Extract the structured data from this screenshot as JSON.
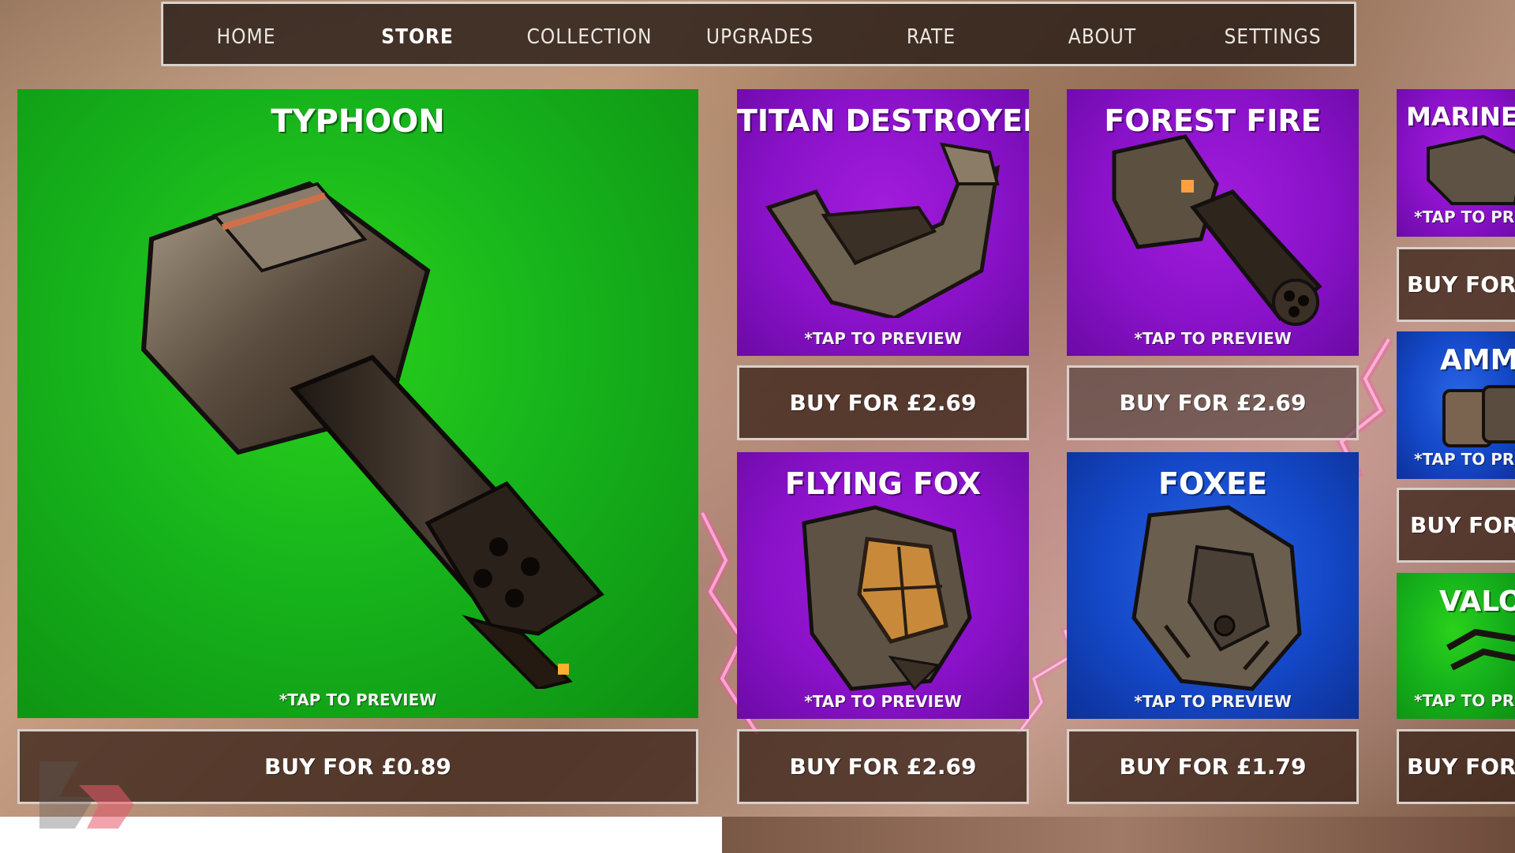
{
  "nav": {
    "items": [
      {
        "label": "HOME",
        "active": false
      },
      {
        "label": "STORE",
        "active": true
      },
      {
        "label": "COLLECTION",
        "active": false
      },
      {
        "label": "UPGRADES",
        "active": false
      },
      {
        "label": "RATE",
        "active": false
      },
      {
        "label": "ABOUT",
        "active": false
      },
      {
        "label": "SETTINGS",
        "active": false
      }
    ]
  },
  "store": {
    "featured": {
      "title": "TYPHOON",
      "tap": "*TAP TO PREVIEW",
      "buy": "BUY FOR £0.89",
      "color": "green"
    },
    "items": [
      {
        "title": "TITAN DESTROYER",
        "tap": "*TAP TO PREVIEW",
        "buy": "BUY FOR £2.69",
        "color": "purple"
      },
      {
        "title": "FOREST FIRE",
        "tap": "*TAP TO PREVIEW",
        "buy": "BUY FOR £2.69",
        "color": "purple"
      },
      {
        "title": "FLYING FOX",
        "tap": "*TAP TO PREVIEW",
        "buy": "BUY FOR £2.69",
        "color": "purple"
      },
      {
        "title": "FOXEE",
        "tap": "*TAP TO PREVIEW",
        "buy": "BUY FOR £1.79",
        "color": "blue"
      }
    ],
    "partial": [
      {
        "title": "MARINE T",
        "tap": "*TAP TO PREV",
        "buy": "BUY FOR £",
        "color": "purple"
      },
      {
        "title": "AMMI",
        "tap": "*TAP TO PREV",
        "buy": "BUY FOR £",
        "color": "blue"
      },
      {
        "title": "VALO",
        "tap": "*TAP TO PREV",
        "buy": "BUY FOR £",
        "color": "green"
      }
    ]
  },
  "colors": {
    "green": "#17b41c",
    "purple": "#8a12c9",
    "blue": "#1448c8",
    "button_bg": "#3c241a",
    "button_border": "#d8d0ca"
  }
}
